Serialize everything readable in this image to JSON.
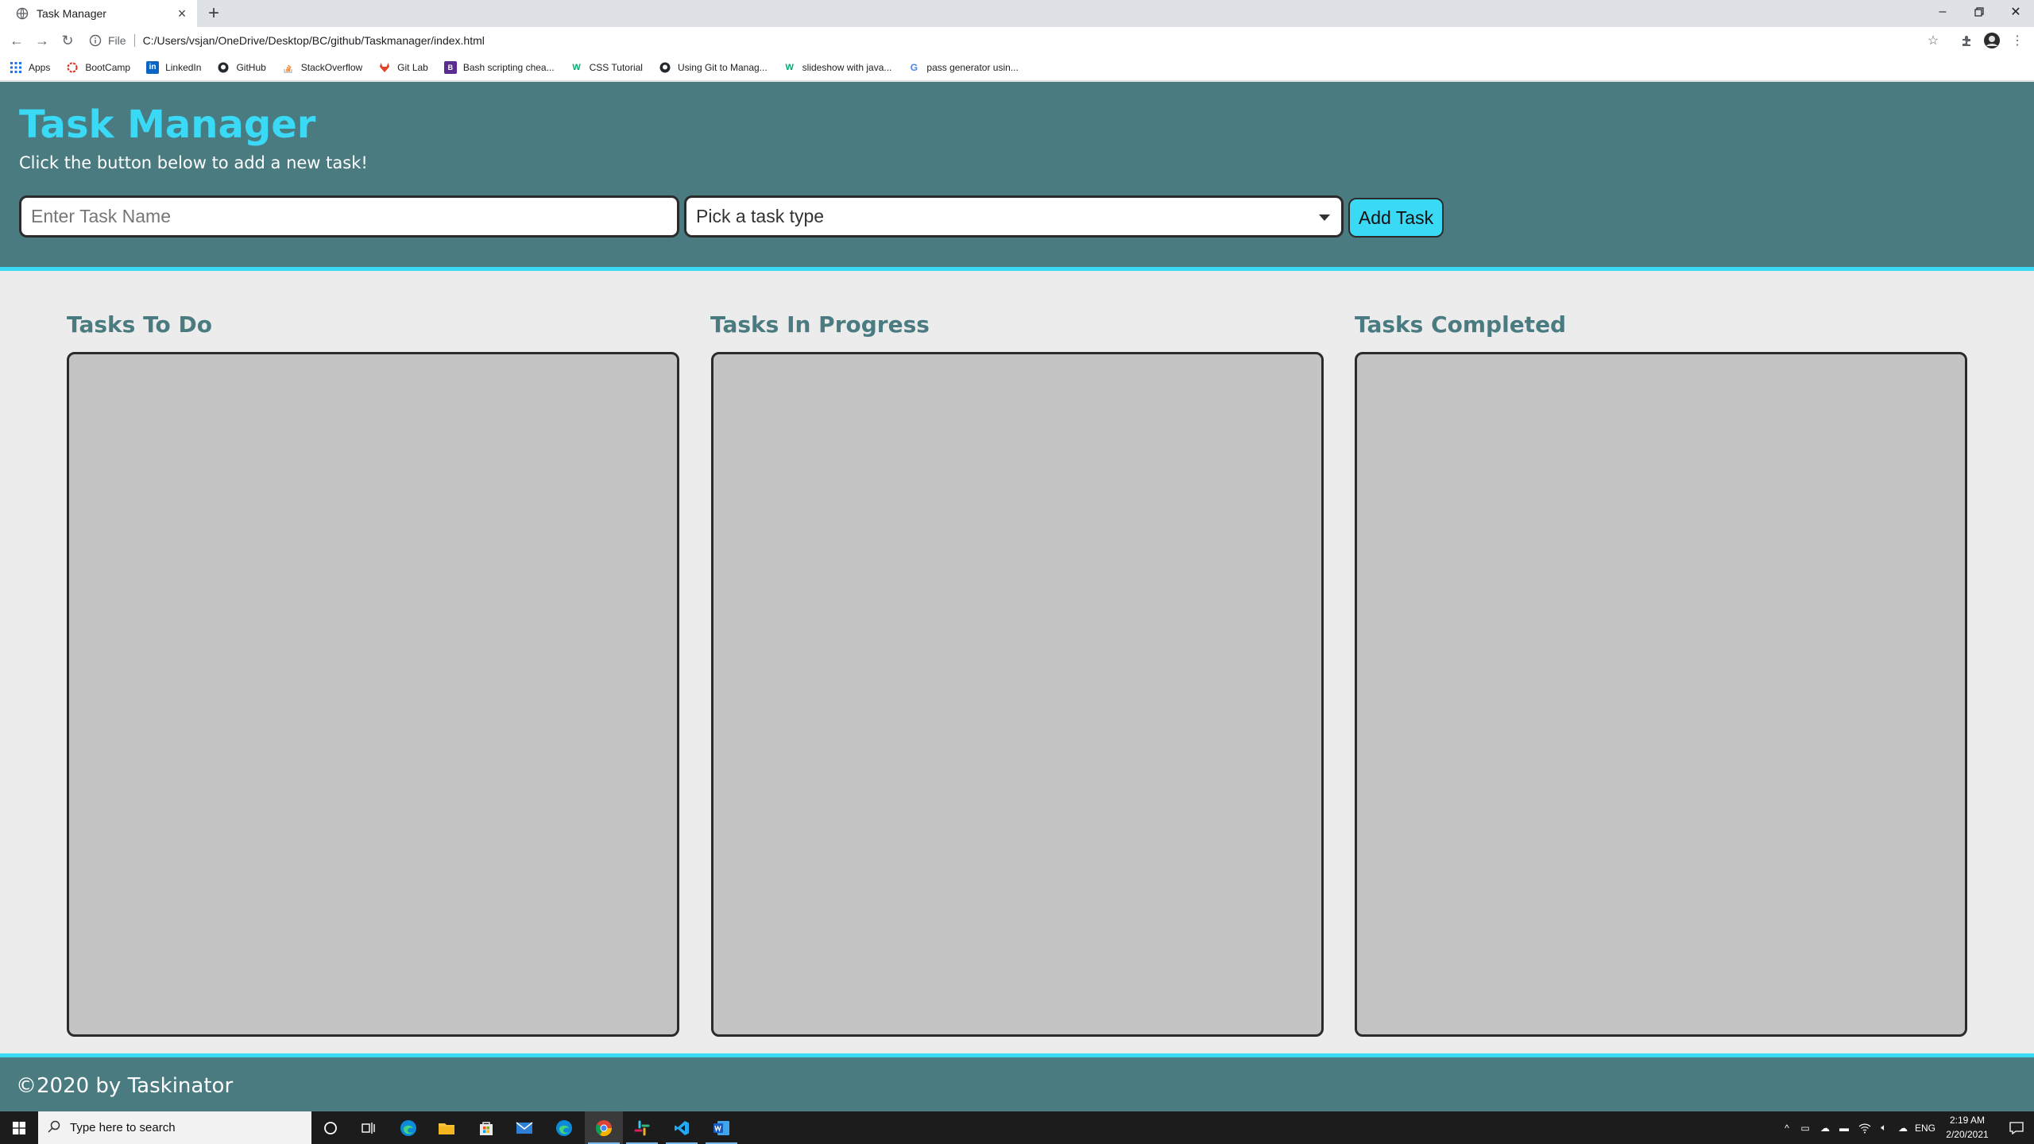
{
  "browser": {
    "tab_title": "Task Manager",
    "url_scheme": "File",
    "url": "C:/Users/vsjan/OneDrive/Desktop/BC/github/Taskmanager/index.html",
    "bookmarks": [
      {
        "label": "Apps",
        "icon": "apps-grid-icon"
      },
      {
        "label": "BootCamp",
        "icon": "bootcamp-icon"
      },
      {
        "label": "LinkedIn",
        "icon": "linkedin-icon"
      },
      {
        "label": "GitHub",
        "icon": "github-icon"
      },
      {
        "label": "StackOverflow",
        "icon": "stackoverflow-icon"
      },
      {
        "label": "Git Lab",
        "icon": "gitlab-icon"
      },
      {
        "label": "Bash scripting chea...",
        "icon": "bash-icon"
      },
      {
        "label": "CSS Tutorial",
        "icon": "w3schools-icon"
      },
      {
        "label": "Using Git to Manag...",
        "icon": "github-icon"
      },
      {
        "label": "slideshow with java...",
        "icon": "w3schools-icon"
      },
      {
        "label": "pass generator usin...",
        "icon": "google-icon"
      }
    ]
  },
  "app": {
    "title": "Task Manager",
    "subtitle": "Click the button below to add a new task!",
    "task_name_placeholder": "Enter Task Name",
    "task_type_value": "Pick a task type",
    "add_button_label": "Add Task",
    "columns": [
      {
        "title": "Tasks To Do"
      },
      {
        "title": "Tasks In Progress"
      },
      {
        "title": "Tasks Completed"
      }
    ],
    "footer": "©2020 by Taskinator"
  },
  "taskbar": {
    "search_placeholder": "Type here to search",
    "language": "ENG",
    "time": "2:19 AM",
    "date": "2/20/2021"
  },
  "colors": {
    "header_bg": "#4a7b80",
    "accent": "#3ad9f5",
    "list_bg": "#c4c4c4",
    "page_bg": "#ececec"
  }
}
